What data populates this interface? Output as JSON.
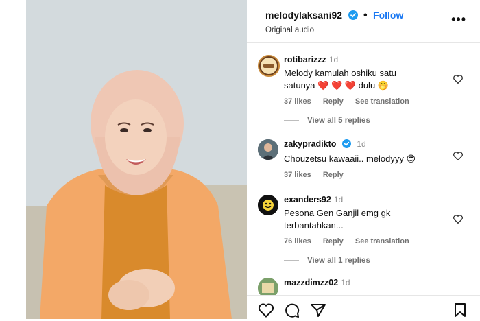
{
  "post": {
    "username": "melodylaksani92",
    "separator": "•",
    "follow_label": "Follow",
    "audio": "Original audio",
    "more_icon": "more-options-icon"
  },
  "comments": [
    {
      "username": "rotibarizzz",
      "time": "1d",
      "text_line1": "Melody kamulah oshiku satu",
      "text_line2_pre": "satunya",
      "text_line2_hearts": "❤️ ❤️ ❤️",
      "text_line2_post": "dulu 🤭",
      "likes": "37 likes",
      "reply": "Reply",
      "translate": "See translation",
      "view_replies": "View all 5 replies"
    },
    {
      "username": "zakypradikto",
      "time": "1d",
      "verified": true,
      "text_line1": "Chouzetsu kawaaii.. melodyyy 😍",
      "likes": "37 likes",
      "reply": "Reply"
    },
    {
      "username": "exanders92",
      "time": "1d",
      "text_line1": "Pesona Gen Ganjil emg gk",
      "text_line2": "terbantahkan...",
      "likes": "76 likes",
      "reply": "Reply",
      "translate": "See translation",
      "view_replies": "View all 1 replies"
    },
    {
      "username": "mazzdimzz02",
      "time": "1d"
    }
  ],
  "colors": {
    "follow": "#1877f2",
    "verified": "#1d9bf0",
    "muted": "#737373",
    "shirt": "#f3a867",
    "hijab": "#efc7b4"
  }
}
